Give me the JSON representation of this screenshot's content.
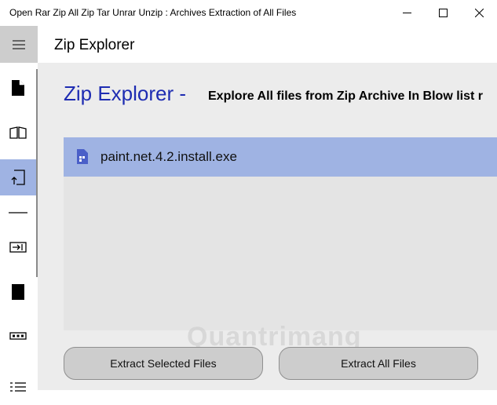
{
  "window": {
    "title": "Open Rar Zip All Zip Tar Unrar Unzip : Archives Extraction of All Files"
  },
  "sidebar": {
    "items": [
      {
        "icon": "document-icon"
      },
      {
        "icon": "open-book-icon"
      },
      {
        "icon": "upload-file-icon"
      },
      {
        "icon": "divider-line-icon"
      },
      {
        "icon": "extract-icon"
      },
      {
        "icon": "sd-card-icon"
      },
      {
        "icon": "dashed-box-icon"
      },
      {
        "icon": "list-icon"
      }
    ]
  },
  "header": {
    "title": "Zip Explorer"
  },
  "main": {
    "title": "Zip Explorer -",
    "subtitle": "Explore All files from Zip Archive In Blow list r",
    "files": [
      {
        "name": "paint.net.4.2.install.exe"
      }
    ],
    "buttons": {
      "extract_selected": "Extract Selected Files",
      "extract_all": "Extract All Files"
    }
  },
  "watermark": "Quantrimang",
  "colors": {
    "accent_title": "#1e2cb2",
    "selected_bg": "#9fb3e3",
    "content_bg": "#ececec"
  }
}
